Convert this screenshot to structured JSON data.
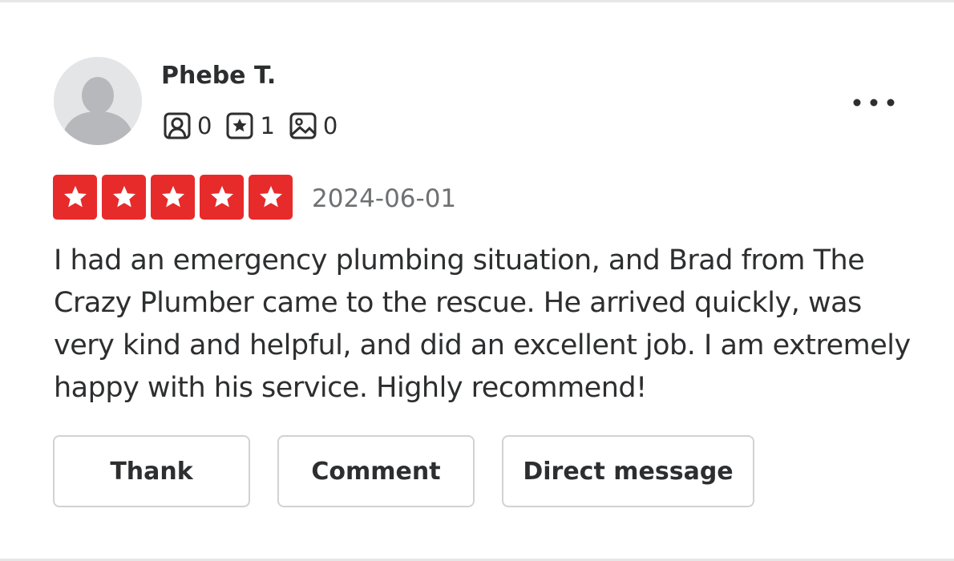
{
  "user": {
    "name": "Phebe T.",
    "stats": {
      "friends": "0",
      "reviews": "1",
      "photos": "0"
    }
  },
  "review": {
    "rating": 5,
    "date": "2024-06-01",
    "text": "I had an emergency plumbing situation, and Brad from The Crazy Plumber came to the rescue. He arrived quickly, was very kind and helpful, and did an excellent job. I am extremely happy with his service. Highly recommend!"
  },
  "actions": {
    "thank_label": "Thank",
    "comment_label": "Comment",
    "dm_label": "Direct message"
  },
  "colors": {
    "star": "#e72b2b",
    "text": "#2d2e2f",
    "muted": "#6e7072",
    "border": "#d2d2d3"
  },
  "icons": {
    "avatar": "default-user-avatar",
    "friends": "friend-icon",
    "reviews": "review-star-icon",
    "photos": "photo-icon",
    "more": "more-horizontal-icon",
    "rating": "star-icon"
  }
}
